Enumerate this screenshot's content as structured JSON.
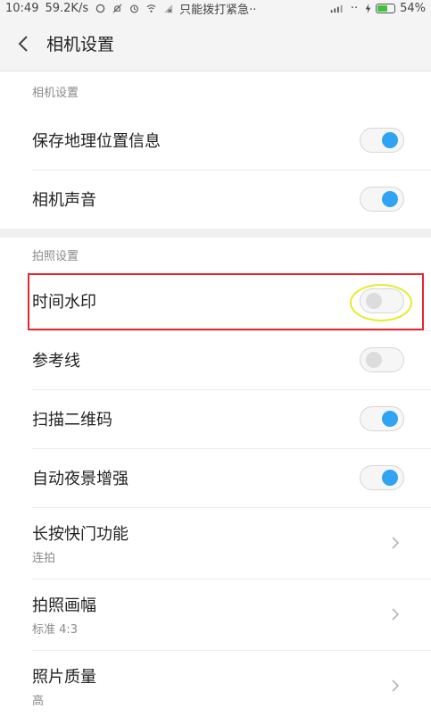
{
  "status_bar": {
    "time": "10:49",
    "speed": "59.2K/s",
    "carrier": "只能拨打紧急··",
    "signal_text": "··",
    "battery": "54%",
    "battery_level": 0.54,
    "icons": [
      "sync-icon",
      "bell-off-icon",
      "alarm-icon",
      "wifi-icon",
      "sim-icon",
      "signal-icon",
      "charging-icon",
      "battery-icon"
    ]
  },
  "header": {
    "title": "相机设置",
    "back_icon": "chevron-left-icon"
  },
  "sections": [
    {
      "label": "相机设置",
      "rows": [
        {
          "label": "保存地理位置信息",
          "control": "toggle",
          "state": "on"
        },
        {
          "label": "相机声音",
          "control": "toggle",
          "state": "on"
        }
      ]
    },
    {
      "label": "拍照设置",
      "rows": [
        {
          "label": "时间水印",
          "control": "toggle",
          "state": "off",
          "highlighted": true
        },
        {
          "label": "参考线",
          "control": "toggle",
          "state": "off"
        },
        {
          "label": "扫描二维码",
          "control": "toggle",
          "state": "on"
        },
        {
          "label": "自动夜景增强",
          "control": "toggle",
          "state": "on"
        },
        {
          "label": "长按快门功能",
          "sub": "连拍",
          "control": "chevron"
        },
        {
          "label": "拍照画幅",
          "sub": "标准 4:3",
          "control": "chevron"
        },
        {
          "label": "照片质量",
          "sub": "高",
          "control": "chevron"
        }
      ]
    }
  ],
  "colors": {
    "toggle_on": "#30a3f2",
    "toggle_off": "#dcdcdc",
    "highlight_box": "#e8242f",
    "highlight_ellipse": "#eaea2a",
    "battery_fill": "#3ec23b"
  }
}
